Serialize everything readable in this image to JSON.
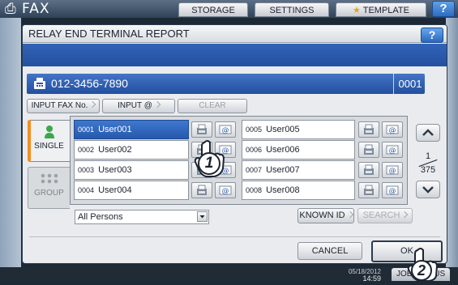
{
  "background": {
    "fax_title": "FAX",
    "tabs": [
      "STORAGE",
      "SETTINGS",
      "TEMPLATE"
    ],
    "help_label": "?",
    "job_tab": "JOB STATUS",
    "date": "05/18/2012",
    "time": "14:59"
  },
  "dialog": {
    "title": "RELAY END TERMINAL REPORT",
    "help_label": "?",
    "fax_number": "012-3456-7890",
    "count": "0001",
    "buttons": {
      "input_fax": "INPUT FAX No.",
      "input_email": "INPUT @",
      "clear": "CLEAR",
      "known_id": "KNOWN ID",
      "search": "SEARCH",
      "cancel": "CANCEL",
      "ok": "OK"
    },
    "tabs": {
      "single": "SINGLE",
      "group": "GROUP"
    },
    "left_entries": [
      {
        "no": "0001",
        "name": "User001",
        "selected": true
      },
      {
        "no": "0002",
        "name": "User002",
        "selected": false
      },
      {
        "no": "0003",
        "name": "User003",
        "selected": false
      },
      {
        "no": "0004",
        "name": "User004",
        "selected": false
      }
    ],
    "right_entries": [
      {
        "no": "0005",
        "name": "User005"
      },
      {
        "no": "0006",
        "name": "User006"
      },
      {
        "no": "0007",
        "name": "User007"
      },
      {
        "no": "0008",
        "name": "User008"
      }
    ],
    "page": {
      "current": "1",
      "total": "375"
    },
    "filter": "All Persons"
  },
  "callouts": {
    "step1": "1",
    "step2": "2"
  },
  "colors": {
    "selected_row": "#2f66bd",
    "title_blue": "#2a5aa8",
    "single_tab_accent": "#f28f20"
  },
  "icons": {
    "fax": "fax-icon",
    "email": "at-icon",
    "single": "person-icon",
    "group": "group-icon"
  }
}
